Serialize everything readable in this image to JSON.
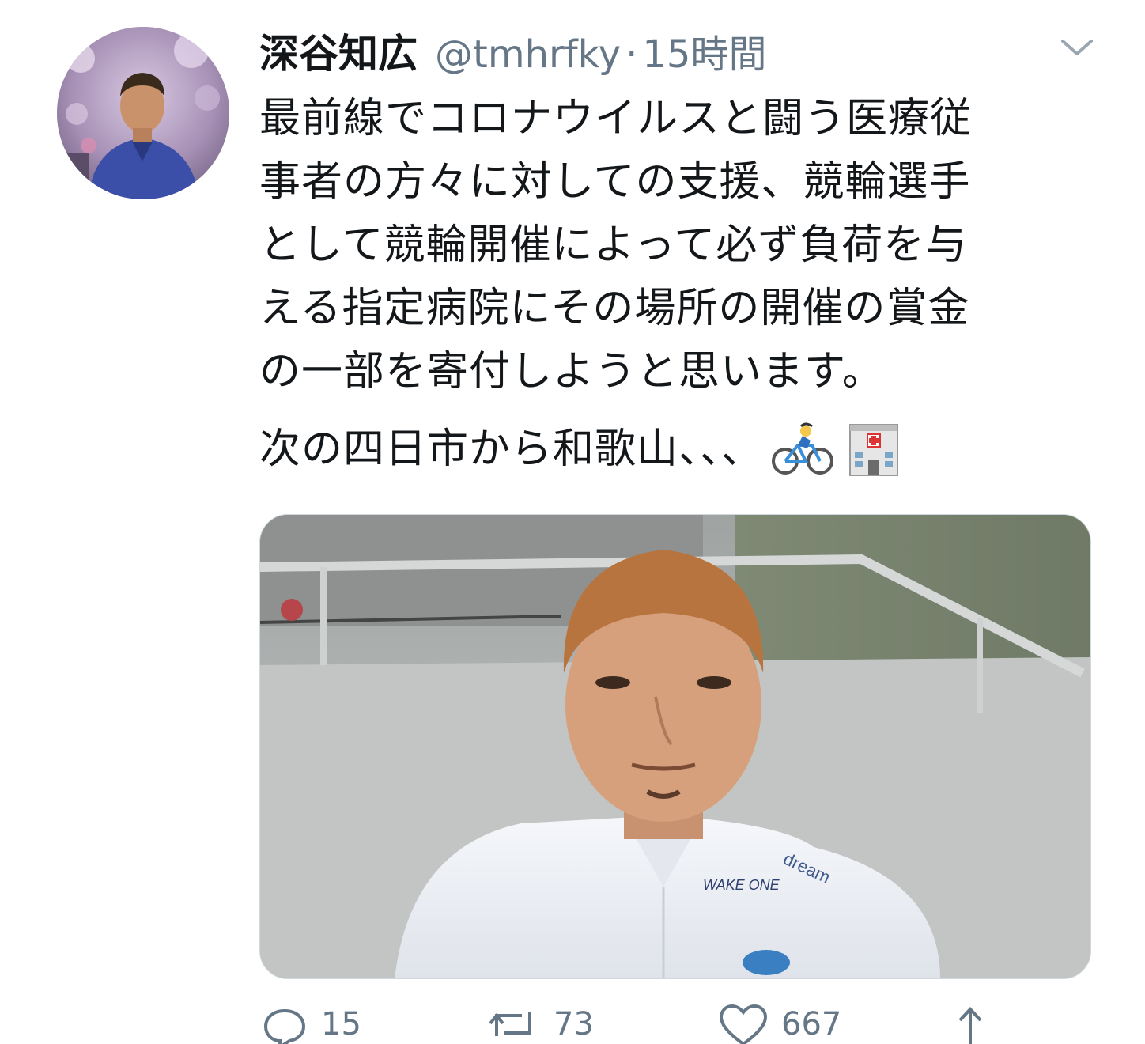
{
  "tweet": {
    "author_name": "深谷知広",
    "handle": "@tmhrfky",
    "separator": "·",
    "time": "15時間",
    "text_lines": [
      "最前線でコロナウイルスと闘う医療従",
      "事者の方々に対しての支援、競輪選手",
      "として競輪開催によって必ず負荷を与",
      "える指定病院にその場所の開催の賞金",
      "の一部を寄付しようと思います。"
    ],
    "second_paragraph": "次の四日市から和歌山、、、",
    "emojis": [
      "bicyclist-icon",
      "hospital-icon"
    ]
  },
  "actions": {
    "reply_count": "15",
    "retweet_count": "73",
    "like_count": "667"
  },
  "colors": {
    "text": "#14171a",
    "secondary": "#657786",
    "border": "#d0d7de"
  }
}
